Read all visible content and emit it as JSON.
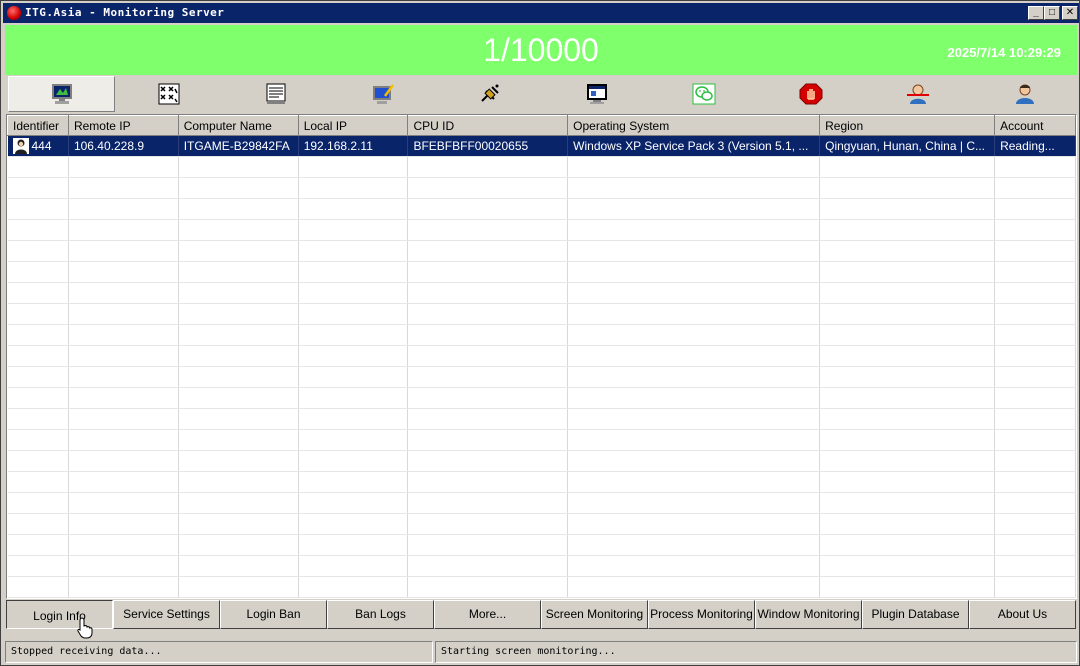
{
  "titlebar": {
    "title": "ITG.Asia - Monitoring Server",
    "minimize": "_",
    "maximize": "□",
    "close": "✕"
  },
  "banner": {
    "count": "1/10000",
    "datetime": "2025/7/14 10:29:29",
    "bg_color": "#80ff6c"
  },
  "icon_toolbar": [
    {
      "icon": "monitor-screen-icon",
      "active": true
    },
    {
      "icon": "pattern-grid-icon",
      "active": false
    },
    {
      "icon": "document-list-icon",
      "active": false
    },
    {
      "icon": "monitor-edit-icon",
      "active": false
    },
    {
      "icon": "satellite-icon",
      "active": false
    },
    {
      "icon": "window-app-icon",
      "active": false
    },
    {
      "icon": "wechat-icon",
      "active": false
    },
    {
      "icon": "stop-hand-icon",
      "active": false
    },
    {
      "icon": "user-ban-icon",
      "active": false
    },
    {
      "icon": "user-icon",
      "active": false
    }
  ],
  "table": {
    "columns": [
      "Identifier",
      "Remote IP",
      "Computer Name",
      "Local IP",
      "CPU ID",
      "Operating System",
      "Region",
      "Account"
    ],
    "rows": [
      [
        "444",
        "106.40.228.9",
        "ITGAME-B29842FA",
        "192.168.2.11",
        "BFEBFBFF00020655",
        "Windows XP Service Pack 3 (Version 5.1, ...",
        "Qingyuan, Hunan, China | C...",
        "Reading..."
      ]
    ],
    "selected_color": "#0a246a"
  },
  "bottom_tabs": [
    {
      "label": "Login Info",
      "active": true
    },
    {
      "label": "Service Settings",
      "active": false
    },
    {
      "label": "Login Ban",
      "active": false
    },
    {
      "label": "Ban Logs",
      "active": false
    },
    {
      "label": "More...",
      "active": false
    },
    {
      "label": "Screen Monitoring",
      "active": false
    },
    {
      "label": "Process Monitoring",
      "active": false
    },
    {
      "label": "Window Monitoring",
      "active": false
    },
    {
      "label": "Plugin Database",
      "active": false
    },
    {
      "label": "About Us",
      "active": false
    }
  ],
  "statusbar": {
    "left": "Stopped receiving data...",
    "right": "Starting screen monitoring..."
  }
}
